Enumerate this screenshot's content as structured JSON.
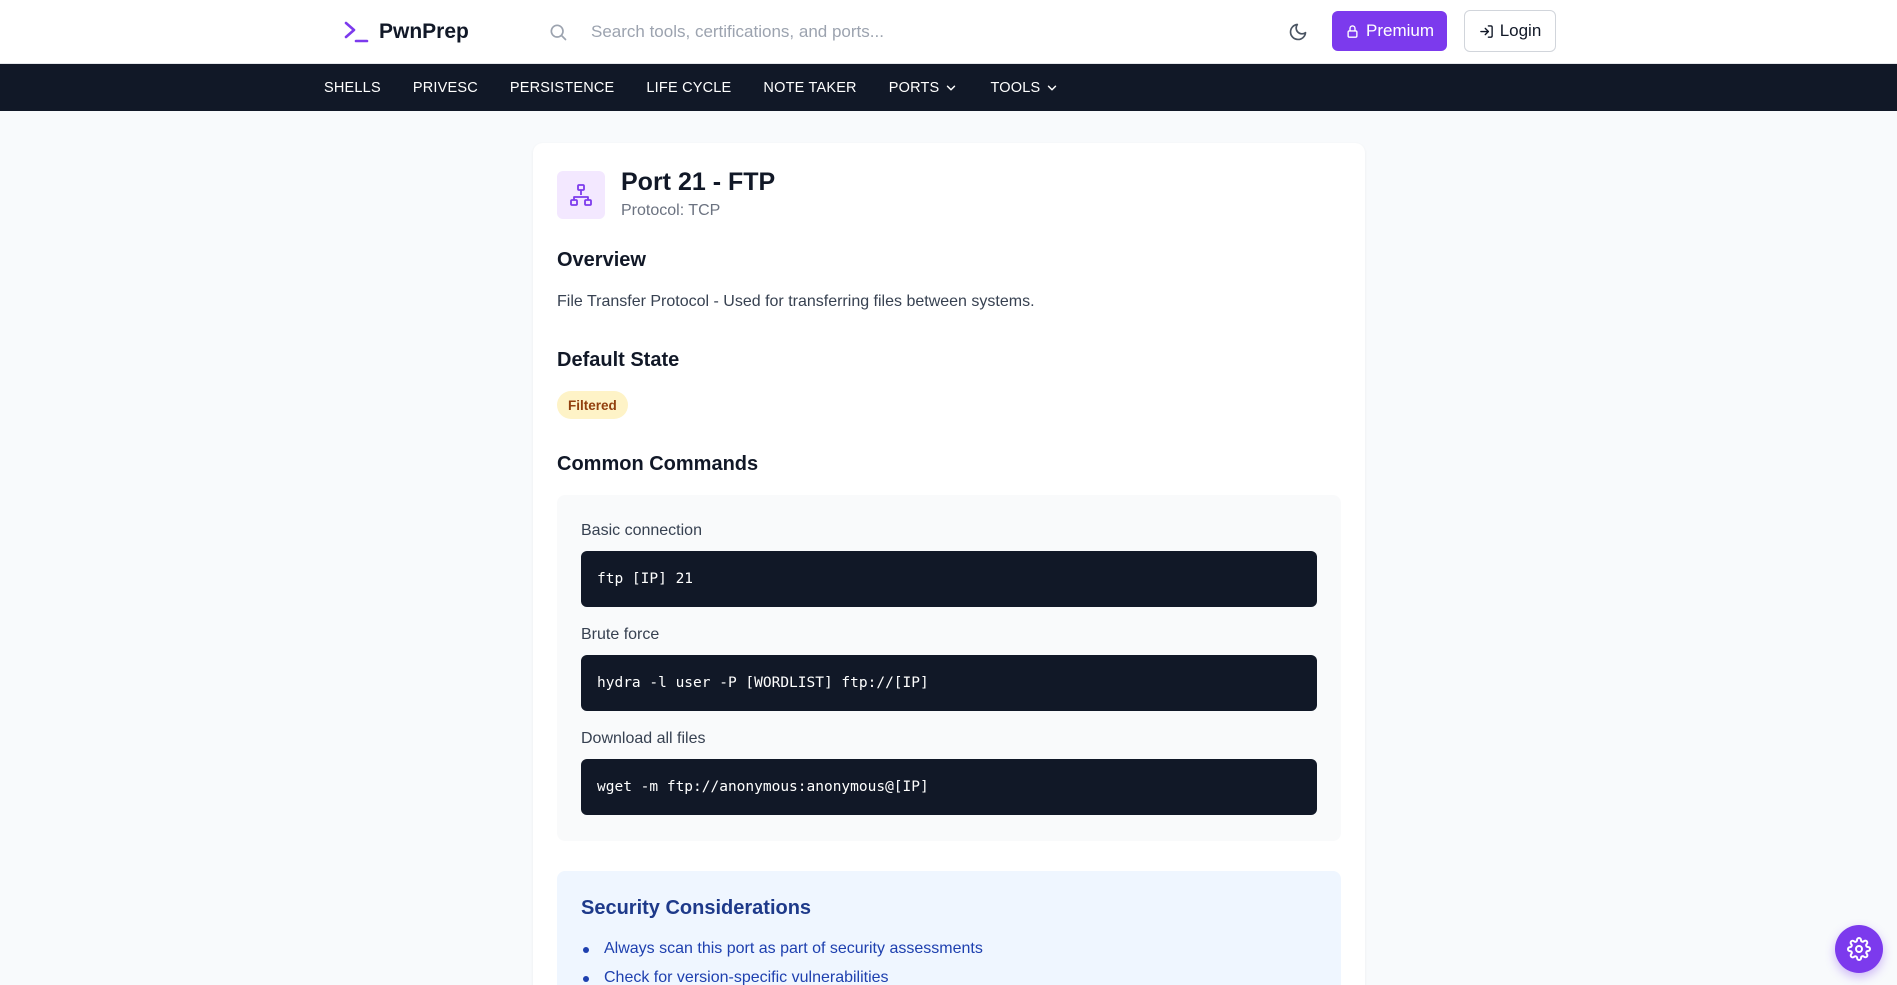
{
  "header": {
    "brand": "PwnPrep",
    "search_placeholder": "Search tools, certifications, and ports...",
    "premium_label": "Premium",
    "login_label": "Login"
  },
  "nav": {
    "items": [
      {
        "label": "SHELLS"
      },
      {
        "label": "PRIVESC"
      },
      {
        "label": "PERSISTENCE"
      },
      {
        "label": "LIFE CYCLE"
      },
      {
        "label": "NOTE TAKER"
      },
      {
        "label": "PORTS",
        "dropdown": true
      },
      {
        "label": "TOOLS",
        "dropdown": true
      }
    ]
  },
  "port": {
    "title": "Port 21 - FTP",
    "protocol": "Protocol: TCP",
    "overview_heading": "Overview",
    "overview_text": "File Transfer Protocol - Used for transferring files between systems.",
    "default_state_heading": "Default State",
    "default_state": "Filtered",
    "commands_heading": "Common Commands",
    "commands": [
      {
        "label": "Basic connection",
        "command": "ftp [IP] 21"
      },
      {
        "label": "Brute force",
        "command": "hydra -l user -P [WORDLIST] ftp://[IP]"
      },
      {
        "label": "Download all files",
        "command": "wget -m ftp://anonymous:anonymous@[IP]"
      }
    ],
    "security_heading": "Security Considerations",
    "security_items": [
      "Always scan this port as part of security assessments",
      "Check for version-specific vulnerabilities"
    ]
  },
  "colors": {
    "accent": "#7c3aed",
    "navbar": "#111827",
    "badge_bg": "#fef3c7",
    "badge_text": "#92400e",
    "security_bg": "#eff6ff"
  },
  "icons": {
    "logo": "terminal-prompt-icon",
    "search": "search-icon",
    "theme": "moon-icon",
    "premium": "lock-icon",
    "login": "login-icon",
    "port": "network-icon",
    "settings": "gear-icon"
  }
}
